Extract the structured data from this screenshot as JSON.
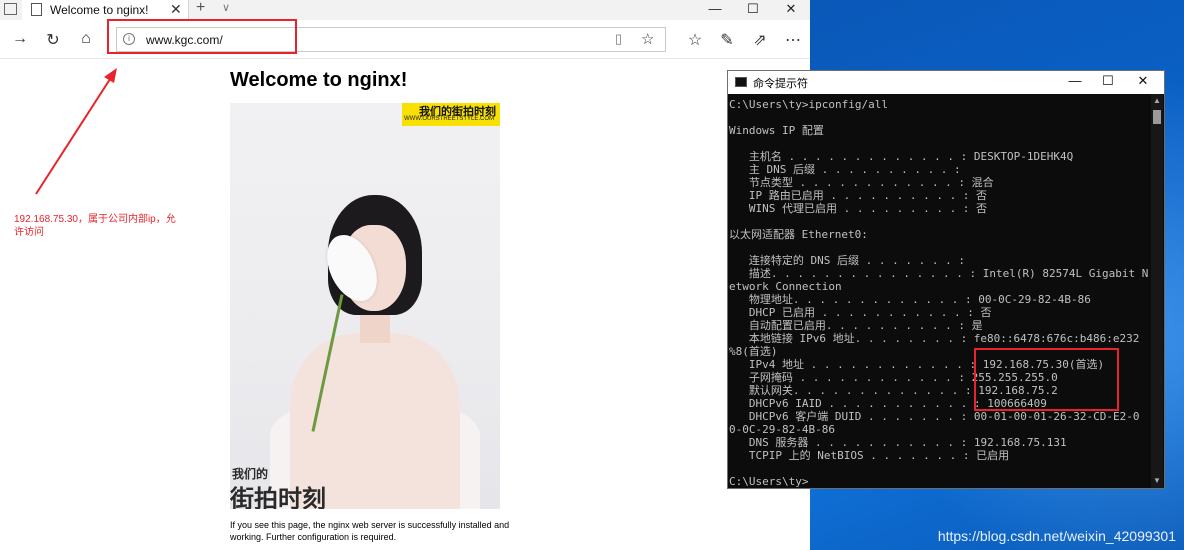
{
  "browser": {
    "tab_title": "Welcome to nginx!",
    "tab_close": "✕",
    "url": "www.kgc.com/",
    "window_controls": [
      "—",
      "☐",
      "✕"
    ]
  },
  "page": {
    "heading": "Welcome to nginx!",
    "body_text": "If you see this page, the nginx web server is successfully installed and working. Further configuration is required.",
    "image_badge": "我们的街拍时刻",
    "image_badge_sub": "WWW.OURSTREETSTYLE.COM",
    "image_logo_small": "我们的",
    "image_logo": "街拍时刻"
  },
  "annotation": {
    "text": "192.168.75.30，属于公司内部ip，允许访问",
    "color": "#e8232b"
  },
  "cmd": {
    "title": "命令提示符",
    "lines": [
      "C:\\Users\\ty>ipconfig/all",
      "",
      "Windows IP 配置",
      "",
      "   主机名 . . . . . . . . . . . . . : DESKTOP-1DEHK4Q",
      "   主 DNS 后缀 . . . . . . . . . . :",
      "   节点类型 . . . . . . . . . . . . : 混合",
      "   IP 路由已启用 . . . . . . . . . . : 否",
      "   WINS 代理已启用 . . . . . . . . . : 否",
      "",
      "以太网适配器 Ethernet0:",
      "",
      "   连接特定的 DNS 后缀 . . . . . . . :",
      "   描述. . . . . . . . . . . . . . . : Intel(R) 82574L Gigabit N",
      "etwork Connection",
      "   物理地址. . . . . . . . . . . . . : 00-0C-29-82-4B-86",
      "   DHCP 已启用 . . . . . . . . . . . : 否",
      "   自动配置已启用. . . . . . . . . . : 是",
      "   本地链接 IPv6 地址. . . . . . . . : fe80::6478:676c:b486:e232",
      "%8(首选)",
      "   IPv4 地址 . . . . . . . . . . . . : 192.168.75.30(首选)",
      "   子网掩码 . . . . . . . . . . . . : 255.255.255.0",
      "   默认网关. . . . . . . . . . . . . : 192.168.75.2",
      "   DHCPv6 IAID . . . . . . . . . . . : 100666409",
      "   DHCPv6 客户端 DUID . . . . . . . : 00-01-00-01-26-32-CD-E2-0",
      "0-0C-29-82-4B-86",
      "   DNS 服务器 . . . . . . . . . . . : 192.168.75.131",
      "   TCPIP 上的 NetBIOS . . . . . . . : 已启用",
      "",
      "C:\\Users\\ty>"
    ]
  },
  "watermark": "https://blog.csdn.net/weixin_42099301"
}
